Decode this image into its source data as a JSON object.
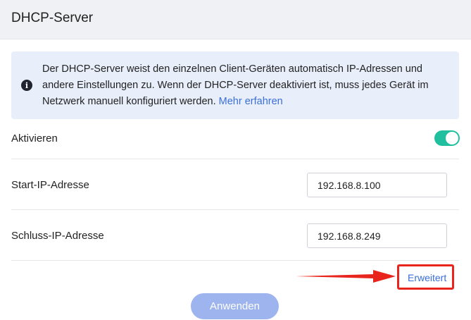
{
  "header": {
    "title": "DHCP-Server"
  },
  "info": {
    "text": "Der DHCP-Server weist den einzelnen Client-Geräten automatisch IP-Adressen und andere Einstellungen zu. Wenn der DHCP-Server deaktiviert ist, muss jedes Gerät im Netzwerk manuell konfiguriert werden. ",
    "link": "Mehr erfahren",
    "icon": "info-icon"
  },
  "activate": {
    "label": "Aktivieren",
    "enabled": true,
    "color": "#1fbfa0"
  },
  "start_ip": {
    "label": "Start-IP-Adresse",
    "value": "192.168.8.100"
  },
  "end_ip": {
    "label": "Schluss-IP-Adresse",
    "value": "192.168.8.249"
  },
  "advanced": {
    "label": "Erweitert",
    "highlight_color": "#e8251d"
  },
  "apply": {
    "label": "Anwenden"
  }
}
